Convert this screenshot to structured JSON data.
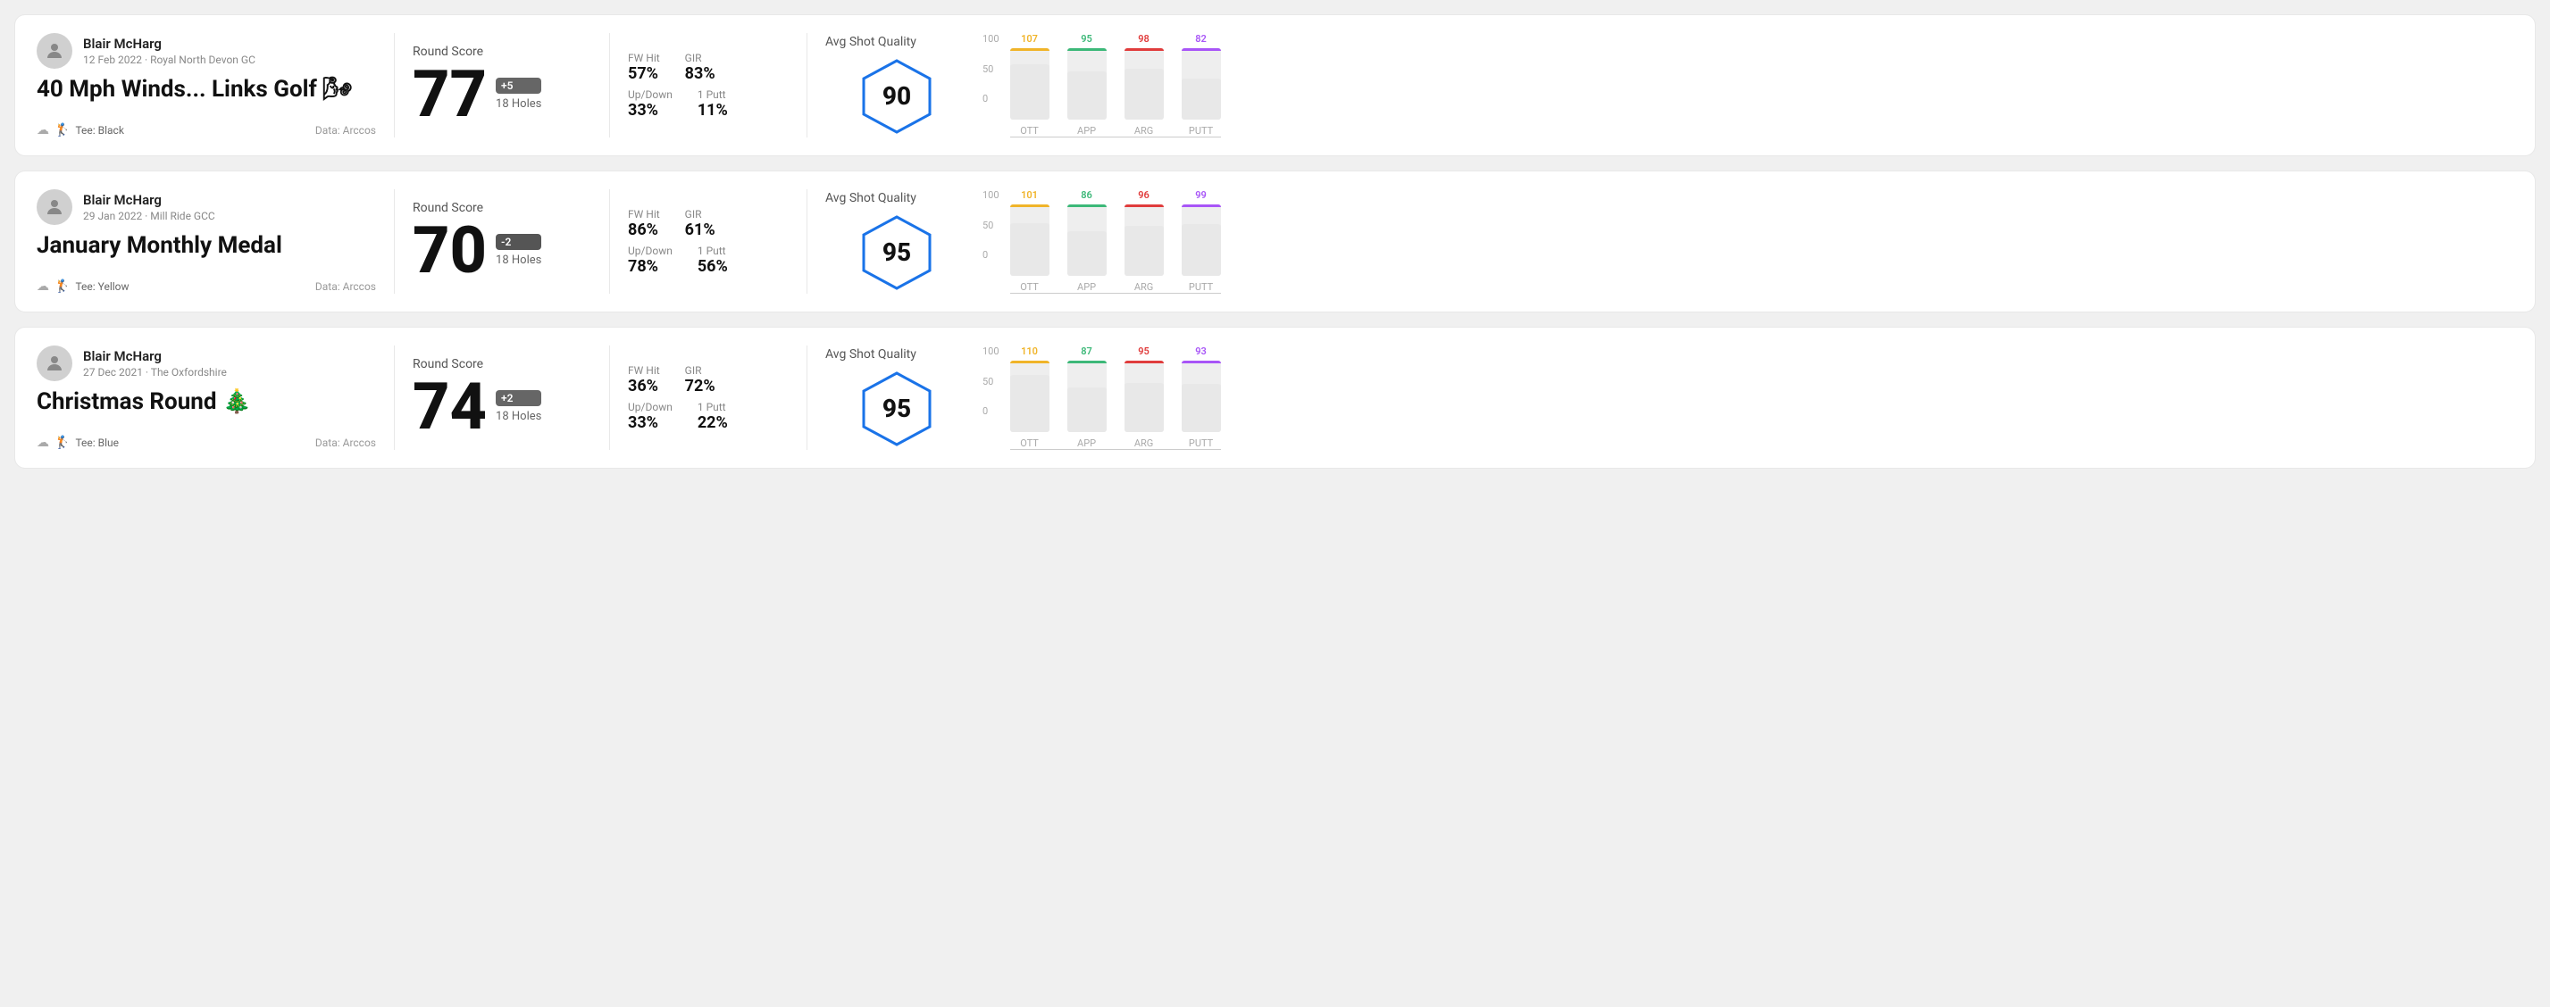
{
  "rounds": [
    {
      "id": "round1",
      "player": {
        "name": "Blair McHarg",
        "date_course": "12 Feb 2022 · Royal North Devon GC"
      },
      "title": "40 Mph Winds... Links Golf 🌬",
      "tee": "Black",
      "data_source": "Data: Arccos",
      "score": {
        "number": "77",
        "badge": "+5",
        "badge_type": "over",
        "holes": "18 Holes"
      },
      "stats": {
        "fw_hit_label": "FW Hit",
        "fw_hit_value": "57%",
        "gir_label": "GIR",
        "gir_value": "83%",
        "updown_label": "Up/Down",
        "updown_value": "33%",
        "oneputt_label": "1 Putt",
        "oneputt_value": "11%"
      },
      "quality": {
        "label": "Avg Shot Quality",
        "value": "90"
      },
      "chart": {
        "bars": [
          {
            "label": "OTT",
            "value": 107,
            "color": "#f0b429",
            "fill_pct": 78
          },
          {
            "label": "APP",
            "value": 95,
            "color": "#3cb878",
            "fill_pct": 68
          },
          {
            "label": "ARG",
            "value": 98,
            "color": "#e03c3c",
            "fill_pct": 71
          },
          {
            "label": "PUTT",
            "value": 82,
            "color": "#a855f7",
            "fill_pct": 58
          }
        ],
        "y_ticks": [
          "100",
          "50",
          "0"
        ]
      }
    },
    {
      "id": "round2",
      "player": {
        "name": "Blair McHarg",
        "date_course": "29 Jan 2022 · Mill Ride GCC"
      },
      "title": "January Monthly Medal",
      "tee": "Yellow",
      "data_source": "Data: Arccos",
      "score": {
        "number": "70",
        "badge": "-2",
        "badge_type": "under",
        "holes": "18 Holes"
      },
      "stats": {
        "fw_hit_label": "FW Hit",
        "fw_hit_value": "86%",
        "gir_label": "GIR",
        "gir_value": "61%",
        "updown_label": "Up/Down",
        "updown_value": "78%",
        "oneputt_label": "1 Putt",
        "oneputt_value": "56%"
      },
      "quality": {
        "label": "Avg Shot Quality",
        "value": "95"
      },
      "chart": {
        "bars": [
          {
            "label": "OTT",
            "value": 101,
            "color": "#f0b429",
            "fill_pct": 74
          },
          {
            "label": "APP",
            "value": 86,
            "color": "#3cb878",
            "fill_pct": 62
          },
          {
            "label": "ARG",
            "value": 96,
            "color": "#e03c3c",
            "fill_pct": 70
          },
          {
            "label": "PUTT",
            "value": 99,
            "color": "#a855f7",
            "fill_pct": 72
          }
        ],
        "y_ticks": [
          "100",
          "50",
          "0"
        ]
      }
    },
    {
      "id": "round3",
      "player": {
        "name": "Blair McHarg",
        "date_course": "27 Dec 2021 · The Oxfordshire"
      },
      "title": "Christmas Round 🎄",
      "tee": "Blue",
      "data_source": "Data: Arccos",
      "score": {
        "number": "74",
        "badge": "+2",
        "badge_type": "over",
        "holes": "18 Holes"
      },
      "stats": {
        "fw_hit_label": "FW Hit",
        "fw_hit_value": "36%",
        "gir_label": "GIR",
        "gir_value": "72%",
        "updown_label": "Up/Down",
        "updown_value": "33%",
        "oneputt_label": "1 Putt",
        "oneputt_value": "22%"
      },
      "quality": {
        "label": "Avg Shot Quality",
        "value": "95"
      },
      "chart": {
        "bars": [
          {
            "label": "OTT",
            "value": 110,
            "color": "#f0b429",
            "fill_pct": 80
          },
          {
            "label": "APP",
            "value": 87,
            "color": "#3cb878",
            "fill_pct": 63
          },
          {
            "label": "ARG",
            "value": 95,
            "color": "#e03c3c",
            "fill_pct": 69
          },
          {
            "label": "PUTT",
            "value": 93,
            "color": "#a855f7",
            "fill_pct": 68
          }
        ],
        "y_ticks": [
          "100",
          "50",
          "0"
        ]
      }
    }
  ],
  "labels": {
    "round_score": "Round Score",
    "data_arccos": "Data: Arccos",
    "tee_prefix": "Tee:"
  }
}
